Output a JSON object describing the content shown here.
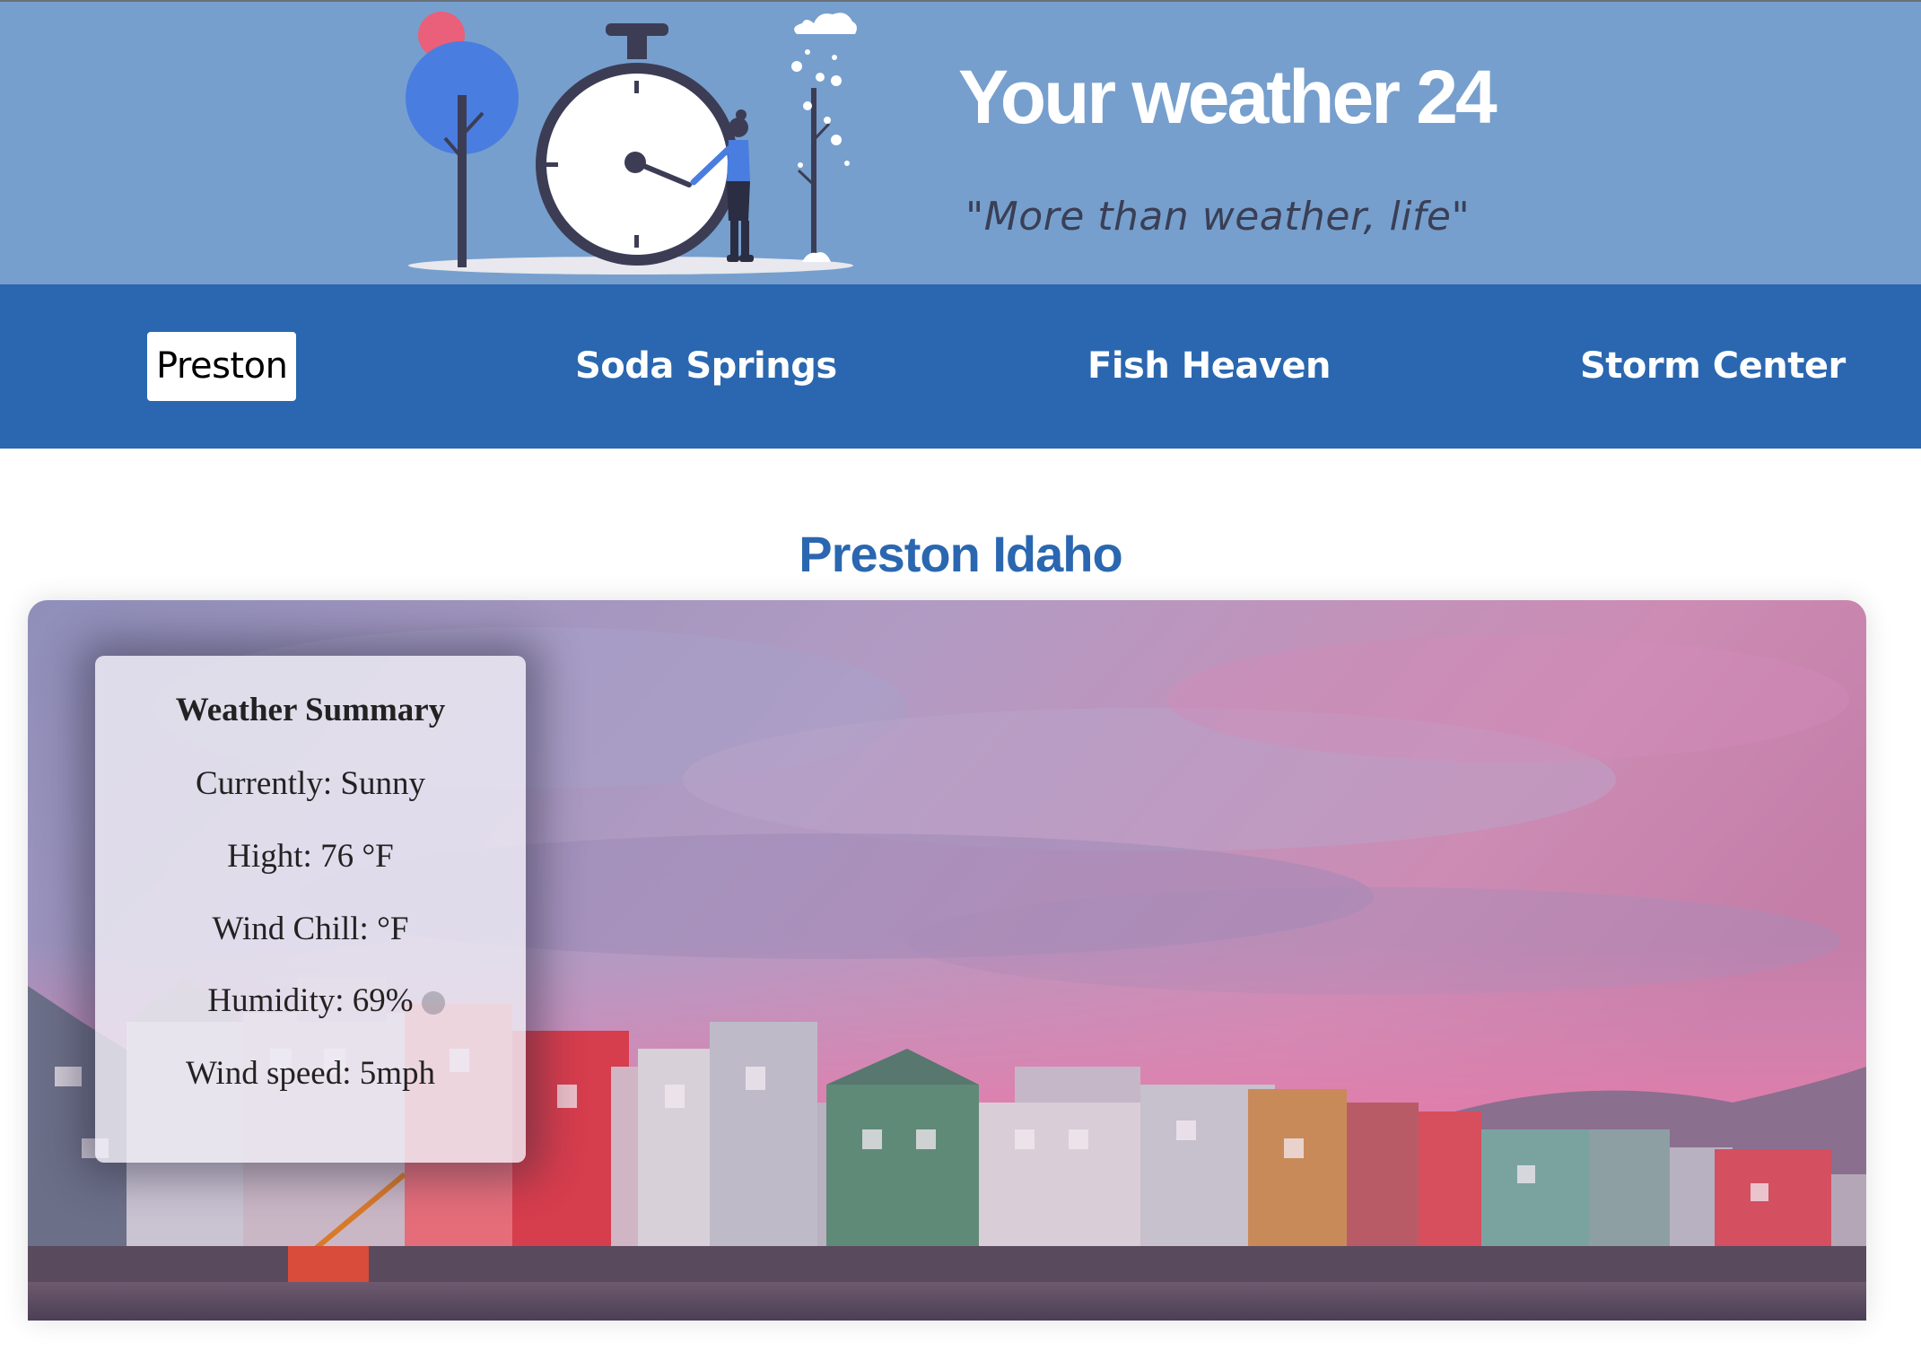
{
  "header": {
    "title": "Your weather 24",
    "tagline": "\"More than weather, life\"",
    "illustration": "clock-with-woman-and-trees-illustration"
  },
  "nav": {
    "items": [
      {
        "label": "Preston",
        "active": true
      },
      {
        "label": "Soda Springs",
        "active": false
      },
      {
        "label": "Fish Heaven",
        "active": false
      },
      {
        "label": "Storm Center",
        "active": false
      }
    ]
  },
  "main": {
    "heading": "Preston Idaho",
    "hero_image": "harbor-buildings-pink-sunset-photo"
  },
  "summary": {
    "title": "Weather Summary",
    "currently": "Currently: Sunny",
    "high": "Hight: 76 °F",
    "wind_chill": "Wind Chill: °F",
    "humidity": "Humidity: 69%",
    "wind_speed": "Wind speed: 5mph"
  },
  "colors": {
    "header_bg": "#769fcd",
    "nav_bg": "#2a67b0",
    "heading": "#2a67b0"
  }
}
